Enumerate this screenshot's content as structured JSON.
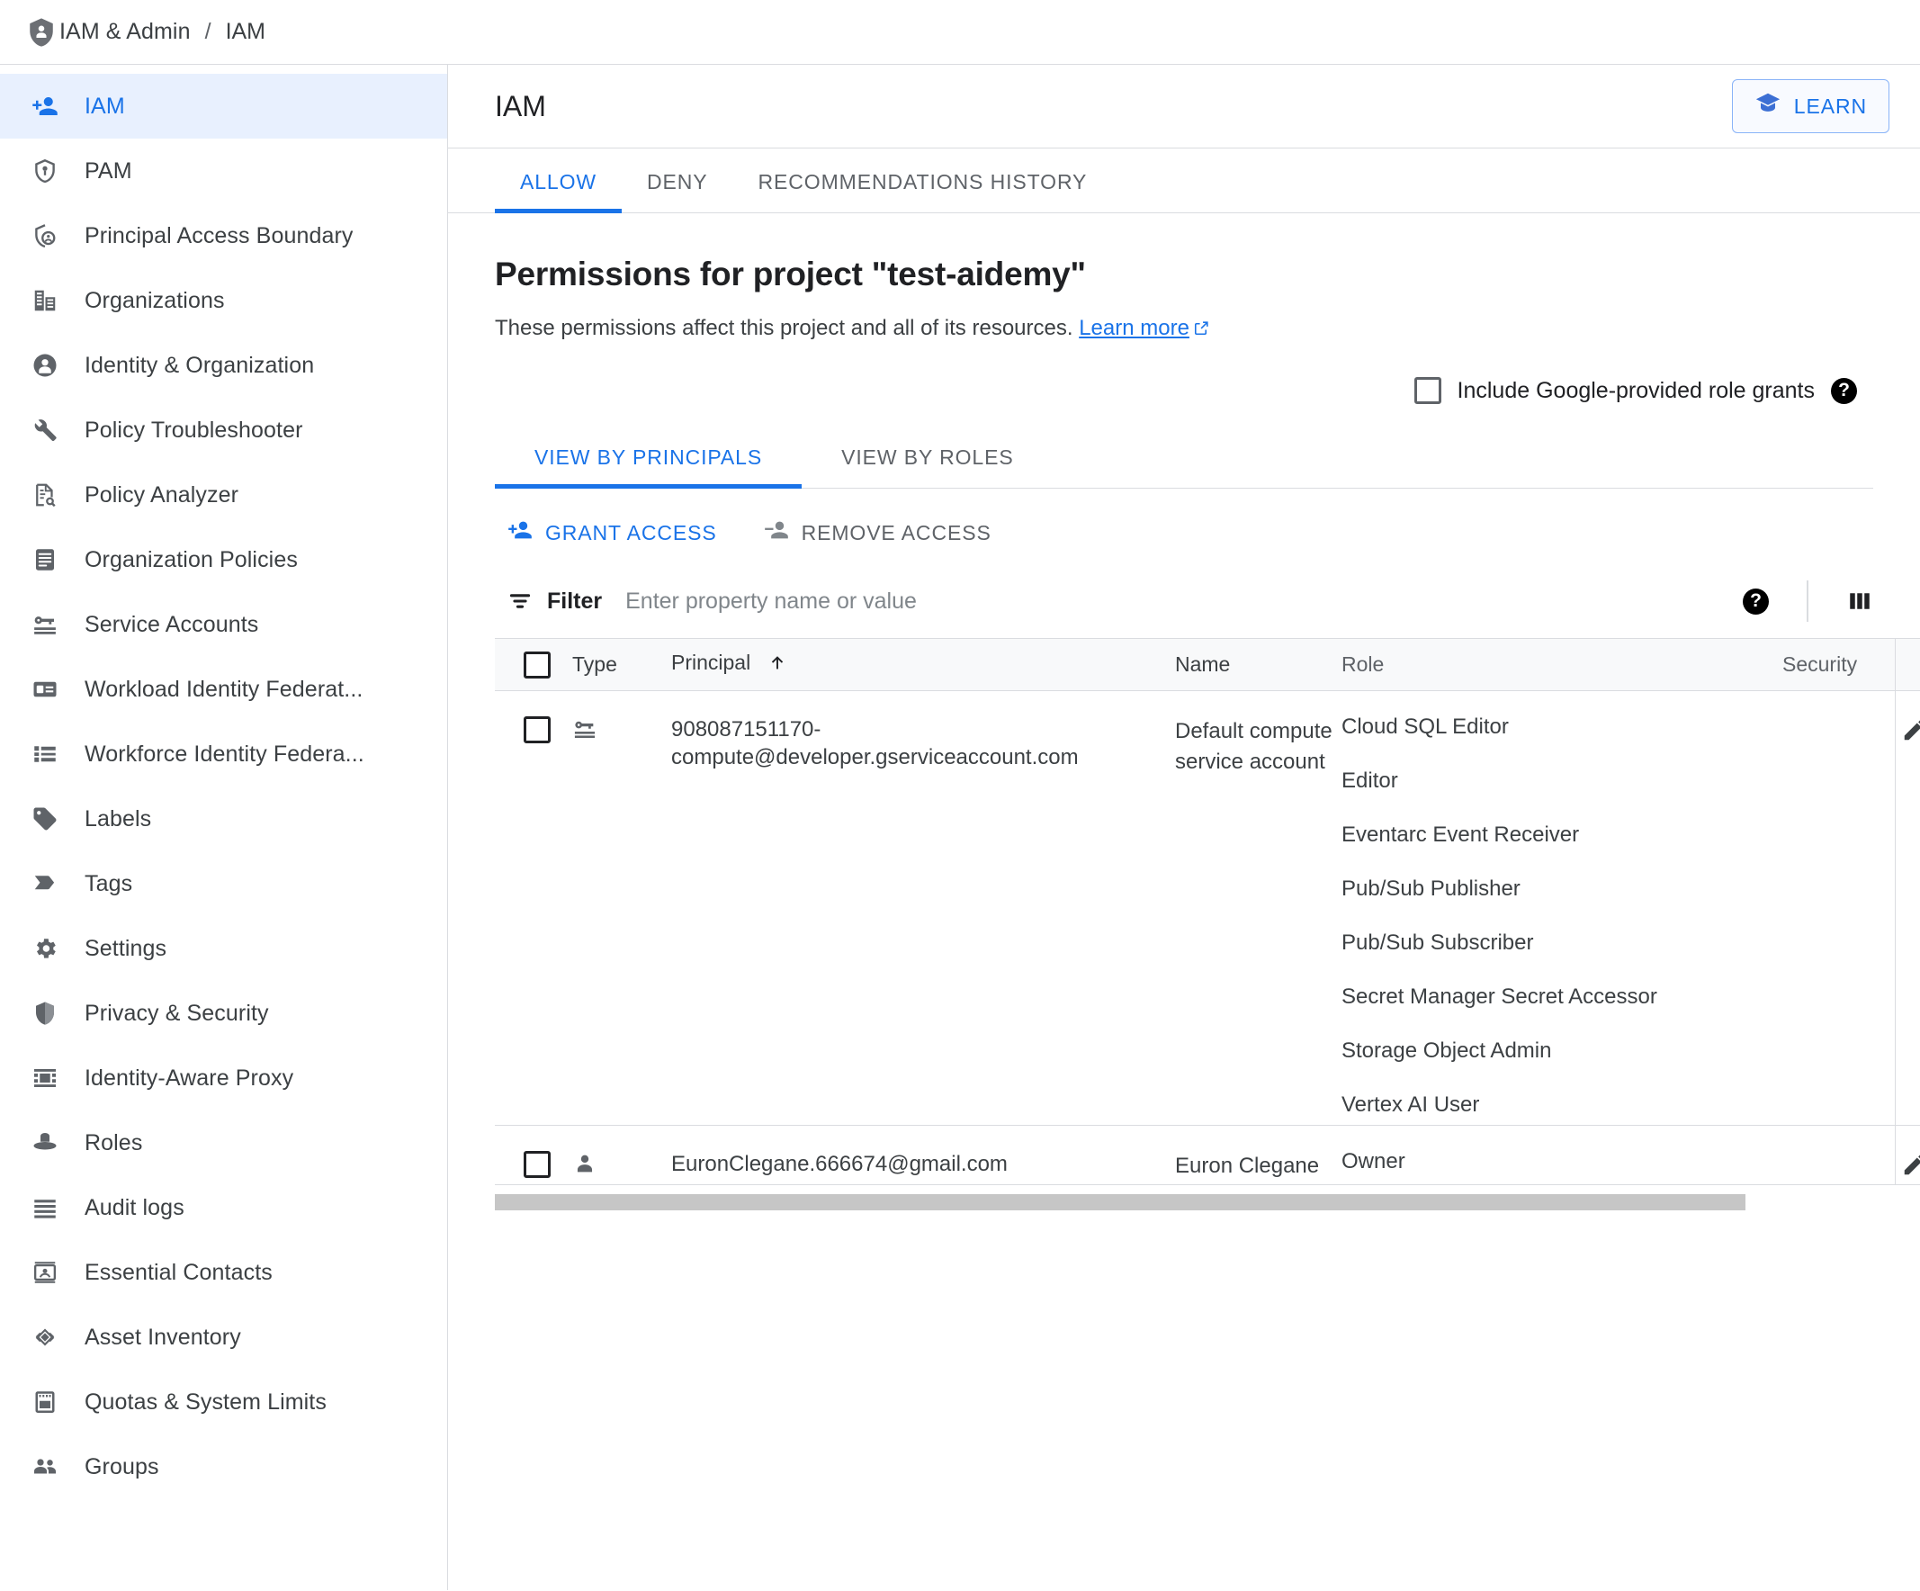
{
  "breadcrumb": {
    "root": "IAM & Admin",
    "separator": "/",
    "current": "IAM",
    "icon": "shield-person-icon"
  },
  "sidebar": {
    "items": [
      {
        "label": "IAM",
        "icon": "person-add-icon",
        "active": true
      },
      {
        "label": "PAM",
        "icon": "shield-key-icon",
        "active": false
      },
      {
        "label": "Principal Access Boundary",
        "icon": "shield-person-outline-icon",
        "active": false
      },
      {
        "label": "Organizations",
        "icon": "org-building-icon",
        "active": false
      },
      {
        "label": "Identity & Organization",
        "icon": "person-circle-icon",
        "active": false
      },
      {
        "label": "Policy Troubleshooter",
        "icon": "wrench-icon",
        "active": false
      },
      {
        "label": "Policy Analyzer",
        "icon": "document-search-icon",
        "active": false
      },
      {
        "label": "Organization Policies",
        "icon": "document-lines-icon",
        "active": false
      },
      {
        "label": "Service Accounts",
        "icon": "key-card-icon",
        "active": false
      },
      {
        "label": "Workload Identity Federat...",
        "icon": "id-card-icon",
        "active": false
      },
      {
        "label": "Workforce Identity Federa...",
        "icon": "list-icon",
        "active": false
      },
      {
        "label": "Labels",
        "icon": "tag-icon",
        "active": false
      },
      {
        "label": "Tags",
        "icon": "chevron-tag-icon",
        "active": false
      },
      {
        "label": "Settings",
        "icon": "gear-icon",
        "active": false
      },
      {
        "label": "Privacy & Security",
        "icon": "shield-icon",
        "active": false
      },
      {
        "label": "Identity-Aware Proxy",
        "icon": "proxy-icon",
        "active": false
      },
      {
        "label": "Roles",
        "icon": "hat-icon",
        "active": false
      },
      {
        "label": "Audit logs",
        "icon": "lines-icon",
        "active": false
      },
      {
        "label": "Essential Contacts",
        "icon": "contact-card-icon",
        "active": false
      },
      {
        "label": "Asset Inventory",
        "icon": "diamond-layers-icon",
        "active": false
      },
      {
        "label": "Quotas & System Limits",
        "icon": "quota-icon",
        "active": false
      },
      {
        "label": "Groups",
        "icon": "people-icon",
        "active": false
      }
    ]
  },
  "header": {
    "title": "IAM",
    "learn_label": "LEARN",
    "learn_icon": "graduation-cap-icon"
  },
  "tabs": [
    {
      "label": "ALLOW",
      "active": true
    },
    {
      "label": "DENY",
      "active": false
    },
    {
      "label": "RECOMMENDATIONS HISTORY",
      "active": false
    }
  ],
  "permissions": {
    "title": "Permissions for project \"test-aidemy\"",
    "description": "These permissions affect this project and all of its resources.",
    "learn_more": "Learn more",
    "learn_more_icon": "external-link-icon",
    "include_google_label": "Include Google-provided role grants",
    "include_google_checked": false,
    "help_icon": "help-circle-icon"
  },
  "subtabs": [
    {
      "label": "VIEW BY PRINCIPALS",
      "active": true
    },
    {
      "label": "VIEW BY ROLES",
      "active": false
    }
  ],
  "actions": {
    "grant_label": "GRANT ACCESS",
    "grant_icon": "person-add-icon",
    "remove_label": "REMOVE ACCESS",
    "remove_icon": "person-remove-icon"
  },
  "filter": {
    "word": "Filter",
    "icon": "filter-icon",
    "placeholder": "Enter property name or value",
    "value": "",
    "help_icon": "help-circle-icon",
    "columns_icon": "columns-icon"
  },
  "table": {
    "columns": {
      "type": "Type",
      "principal": "Principal",
      "sort_icon": "arrow-up-icon",
      "name": "Name",
      "role": "Role",
      "security": "Security"
    },
    "rows": [
      {
        "type_icon": "service-account-icon",
        "principal": "908087151170-compute@developer.gserviceaccount.com",
        "name": "Default compute service account",
        "roles": [
          "Cloud SQL Editor",
          "Editor",
          "Eventarc Event Receiver",
          "Pub/Sub Publisher",
          "Pub/Sub Subscriber",
          "Secret Manager Secret Accessor",
          "Storage Object Admin",
          "Vertex AI User"
        ],
        "edit_icon": "pencil-icon"
      },
      {
        "type_icon": "user-icon",
        "principal": "EuronClegane.666674@gmail.com",
        "name": "Euron Clegane",
        "roles": [
          "Owner"
        ],
        "edit_icon": "pencil-icon"
      }
    ]
  },
  "colors": {
    "accent": "#1a73e8",
    "accent_light": "#e8f0fe",
    "text": "#202124",
    "text_secondary": "#5f6368",
    "border": "#dadce0",
    "header_bg": "#f8f9fa",
    "scrollbar": "#c6c6c6"
  }
}
